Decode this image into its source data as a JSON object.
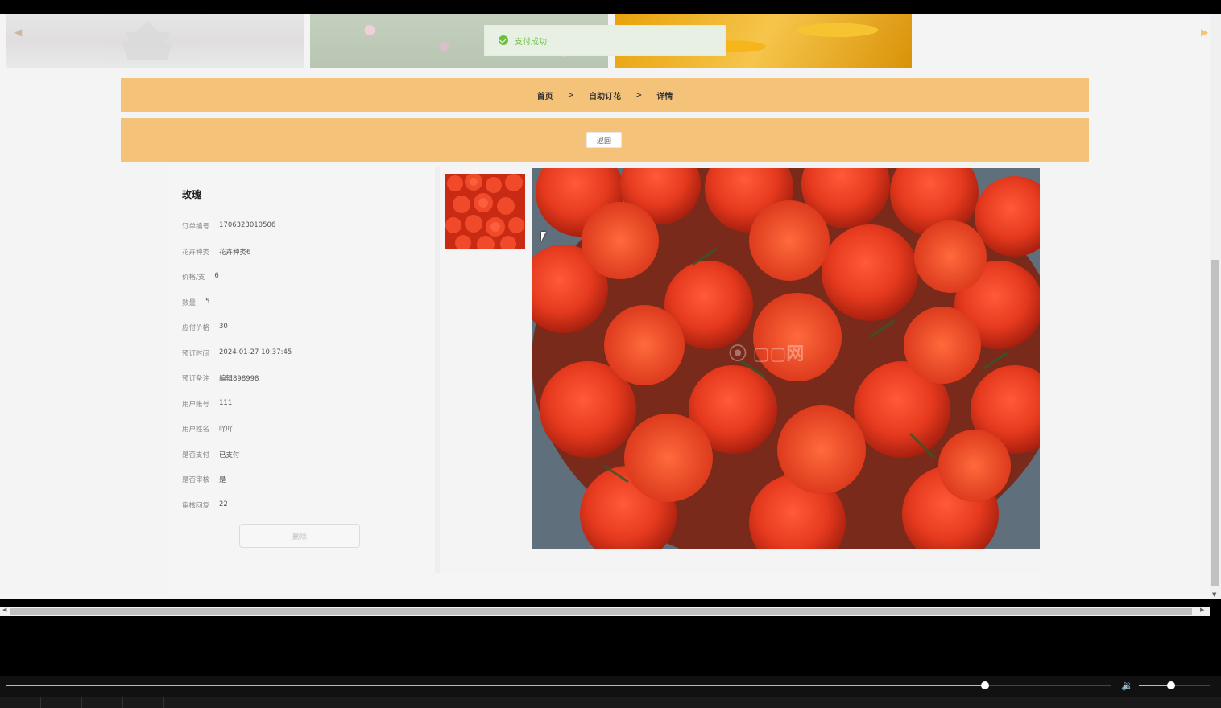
{
  "toast": {
    "text": "支付成功",
    "icon": "check-circle-icon"
  },
  "breadcrumb": {
    "home": "首页",
    "sep1": ">",
    "middle": "自助订花",
    "sep2": ">",
    "current": "详情"
  },
  "back_label": "返回",
  "product": {
    "title": "玫瑰",
    "fields": [
      {
        "label": "订单编号",
        "value": "1706323010506"
      },
      {
        "label": "花卉种类",
        "value": "花卉种类6"
      },
      {
        "label": "价格/支",
        "value": "6"
      },
      {
        "label": "数量",
        "value": "5"
      },
      {
        "label": "应付价格",
        "value": "30"
      },
      {
        "label": "预订时间",
        "value": "2024-01-27 10:37:45"
      },
      {
        "label": "预订备注",
        "value": "编辑898998"
      },
      {
        "label": "用户账号",
        "value": "111"
      },
      {
        "label": "用户姓名",
        "value": "吖吖"
      },
      {
        "label": "是否支付",
        "value": "已支付"
      },
      {
        "label": "是否审核",
        "value": "是"
      },
      {
        "label": "审核回复",
        "value": "22"
      }
    ],
    "delete_label": "删除"
  },
  "player": {
    "progress": 0.886,
    "volume": 0.45
  },
  "colors": {
    "accent_bar": "#f5c27a",
    "success": "#67c23a",
    "seek": "#e8c11a"
  }
}
